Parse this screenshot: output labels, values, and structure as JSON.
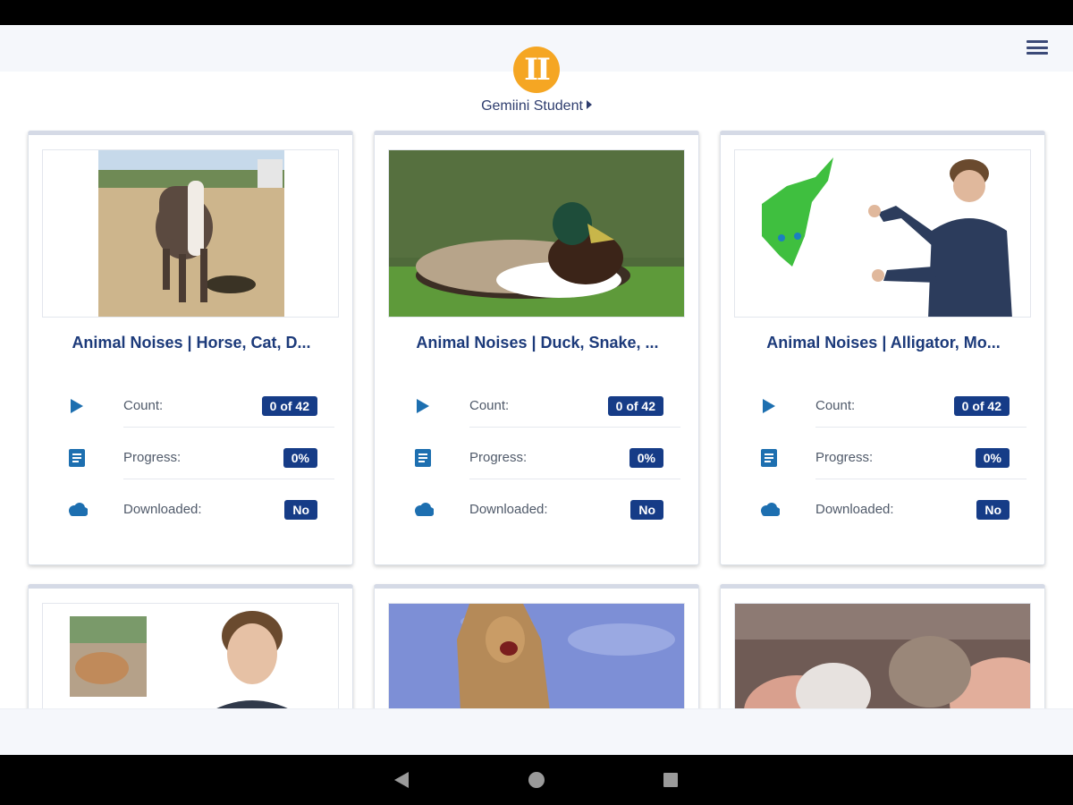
{
  "app": {
    "logo_text": "II",
    "user_menu_label": "Gemiini Student",
    "accent_color": "#f5a623",
    "brand_color": "#163c87"
  },
  "stat_labels": {
    "count": "Count:",
    "progress": "Progress:",
    "downloaded": "Downloaded:"
  },
  "icons": {
    "count": "play-icon",
    "progress": "document-icon",
    "downloaded": "cloud-icon",
    "menu": "hamburger-menu-icon"
  },
  "cards": [
    {
      "title": "Animal Noises | Horse, Cat, D...",
      "count": "0 of 42",
      "progress": "0%",
      "downloaded": "No",
      "thumbnail": "horse walking in dirt paddock"
    },
    {
      "title": "Animal Noises | Duck, Snake, ...",
      "count": "0 of 42",
      "progress": "0%",
      "downloaded": "No",
      "thumbnail": "mallard duck resting on grass"
    },
    {
      "title": "Animal Noises | Alligator, Mo...",
      "count": "0 of 42",
      "progress": "0%",
      "downloaded": "No",
      "thumbnail": "green alligator toy and woman signing"
    },
    {
      "thumbnail": "goat photo and woman speaking"
    },
    {
      "thumbnail": "cougar roaring against blue sky"
    },
    {
      "thumbnail": "two small hamsters in hands"
    }
  ],
  "system_nav": {
    "back": "back-icon",
    "home": "home-icon",
    "recents": "recents-icon"
  }
}
